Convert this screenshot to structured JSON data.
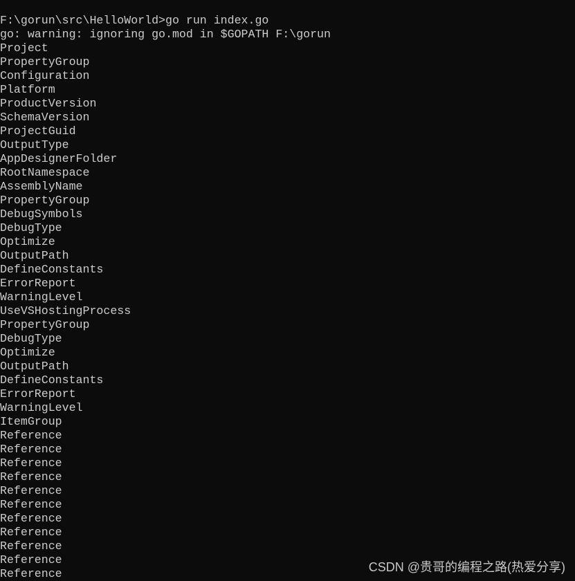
{
  "terminal": {
    "lines": [
      "F:\\gorun\\src\\HelloWorld>go run index.go",
      "go: warning: ignoring go.mod in $GOPATH F:\\gorun",
      "Project",
      "PropertyGroup",
      "Configuration",
      "Platform",
      "ProductVersion",
      "SchemaVersion",
      "ProjectGuid",
      "OutputType",
      "AppDesignerFolder",
      "RootNamespace",
      "AssemblyName",
      "PropertyGroup",
      "DebugSymbols",
      "DebugType",
      "Optimize",
      "OutputPath",
      "DefineConstants",
      "ErrorReport",
      "WarningLevel",
      "UseVSHostingProcess",
      "PropertyGroup",
      "DebugType",
      "Optimize",
      "OutputPath",
      "DefineConstants",
      "ErrorReport",
      "WarningLevel",
      "ItemGroup",
      "Reference",
      "Reference",
      "Reference",
      "Reference",
      "Reference",
      "Reference",
      "Reference",
      "Reference",
      "Reference",
      "Reference",
      "Reference"
    ]
  },
  "watermark": "CSDN @贵哥的编程之路(热爱分享)",
  "colors": {
    "background": "#0c0c0c",
    "text": "#cccccc"
  }
}
